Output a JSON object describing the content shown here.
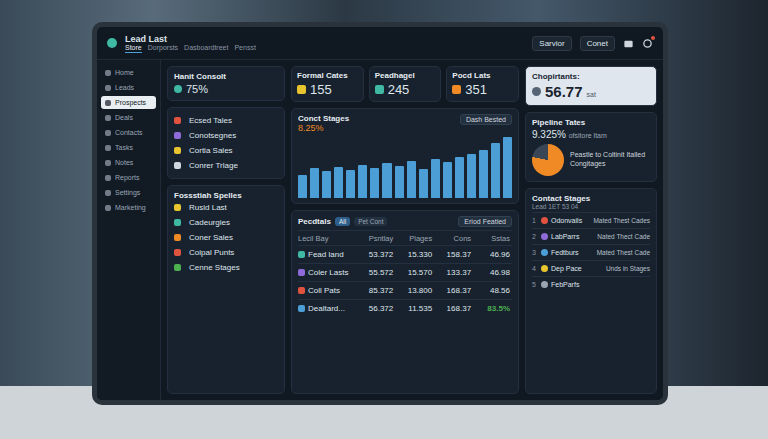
{
  "window": {
    "title": "Lead Last"
  },
  "tabs": [
    {
      "label": "Store",
      "selected": true
    },
    {
      "label": "Dorporsts",
      "selected": false
    },
    {
      "label": "Dasboardtreet",
      "selected": false
    },
    {
      "label": "Pensst",
      "selected": false
    }
  ],
  "header_actions": {
    "primary": "Sarvior",
    "secondary": "Conet",
    "notification": true
  },
  "sidebar": {
    "items": [
      {
        "label": "Home",
        "selected": false
      },
      {
        "label": "Leads",
        "selected": false
      },
      {
        "label": "Prospects",
        "selected": true
      },
      {
        "label": "Deals",
        "selected": false
      },
      {
        "label": "Contacts",
        "selected": false
      },
      {
        "label": "Tasks",
        "selected": false
      },
      {
        "label": "Notes",
        "selected": false
      },
      {
        "label": "Reports",
        "selected": false
      },
      {
        "label": "Settings",
        "selected": false
      },
      {
        "label": "Marketing",
        "selected": false
      }
    ]
  },
  "kpi": {
    "title": "Hanit Consolt",
    "value": "75%"
  },
  "quick_list": [
    {
      "label": "Ecsed Tales",
      "color": "#e0533f"
    },
    {
      "label": "Conotsegnes",
      "color": "#8e6bd8"
    },
    {
      "label": "Cortia Sales",
      "color": "#e8c42f"
    },
    {
      "label": "Conrer Trlage",
      "color": "#cfd6de"
    }
  ],
  "stats": [
    {
      "label": "Formal Cates",
      "value": "155",
      "color": "#e8c42f"
    },
    {
      "label": "Peadhagel",
      "value": "245",
      "color": "#3fb9a3"
    },
    {
      "label": "Pocd Lats",
      "value": "351",
      "color": "#f08a24"
    }
  ],
  "highlight": {
    "title": "Chopirtants:",
    "value": "56.77",
    "unit": "sat"
  },
  "chart": {
    "title": "Conct Stages",
    "value": "8.25%",
    "button": "Dash Bested",
    "series": [
      {
        "name": "Stages",
        "color": "#4b9fd6",
        "values": [
          30,
          38,
          34,
          40,
          36,
          42,
          39,
          45,
          41,
          47,
          37,
          50,
          46,
          52,
          56,
          62,
          70,
          78
        ]
      }
    ]
  },
  "pipeline": {
    "title": "Pipeline Tates",
    "value": "9.325%",
    "caption": "ofsitore ltam",
    "legend": "Peastle to Coltinit Italled Congitages",
    "slices": [
      {
        "value": 78,
        "color": "#f08a24"
      },
      {
        "value": 22,
        "color": "#3a4656"
      }
    ]
  },
  "segments": {
    "title": "Fossstiah Spelles",
    "items": [
      {
        "label": "Rusid Last",
        "color": "#e8c42f"
      },
      {
        "label": "Cadeurgies",
        "color": "#3fb9a3"
      },
      {
        "label": "Coner Sales",
        "color": "#f08a24"
      },
      {
        "label": "Coipal Punts",
        "color": "#e0533f"
      },
      {
        "label": "Cenne Stages",
        "color": "#4caf50"
      }
    ]
  },
  "table": {
    "title": "Pecdtals",
    "button": "Eriod Featied",
    "filters": [
      {
        "label": "All",
        "selected": true
      },
      {
        "label": "Pet Cont",
        "selected": false
      }
    ],
    "columns": [
      "Lecil Bay",
      "Psntlay",
      "Plages",
      "Cons",
      "Sstas"
    ],
    "rows": [
      {
        "cells": [
          "Fead land",
          "53.372",
          "15.330",
          "158.37",
          "46.96"
        ],
        "color": "#3fb9a3",
        "positive": false
      },
      {
        "cells": [
          "Coler Lasts",
          "55.572",
          "15.570",
          "133.37",
          "46.98"
        ],
        "color": "#8e6bd8",
        "positive": false
      },
      {
        "cells": [
          "Coll Pats",
          "85.372",
          "13.800",
          "168.37",
          "48.56"
        ],
        "color": "#e0533f",
        "positive": false
      },
      {
        "cells": [
          "Dealtard...",
          "56.372",
          "11.535",
          "168.37",
          "83.5%"
        ],
        "color": "#4b9fd6",
        "positive": true
      }
    ]
  },
  "contact_stages": {
    "title": "Contact Stages",
    "subtitle": "Lead 1ET 53 04",
    "items": [
      {
        "index": "1",
        "name": "Odonvails",
        "stage": "Mated Thest Cades",
        "color": "#e0533f"
      },
      {
        "index": "2",
        "name": "LabParrs",
        "stage": "Nated Thect Cade",
        "color": "#8e6bd8"
      },
      {
        "index": "3",
        "name": "Fedtburs",
        "stage": "Mated Thest Cade",
        "color": "#4b9fd6"
      },
      {
        "index": "4",
        "name": "Dep Pace",
        "stage": "Unds in Stages",
        "color": "#e8c42f"
      },
      {
        "index": "5",
        "name": "FebParfs",
        "stage": "",
        "color": "#9aa4b0"
      }
    ]
  }
}
